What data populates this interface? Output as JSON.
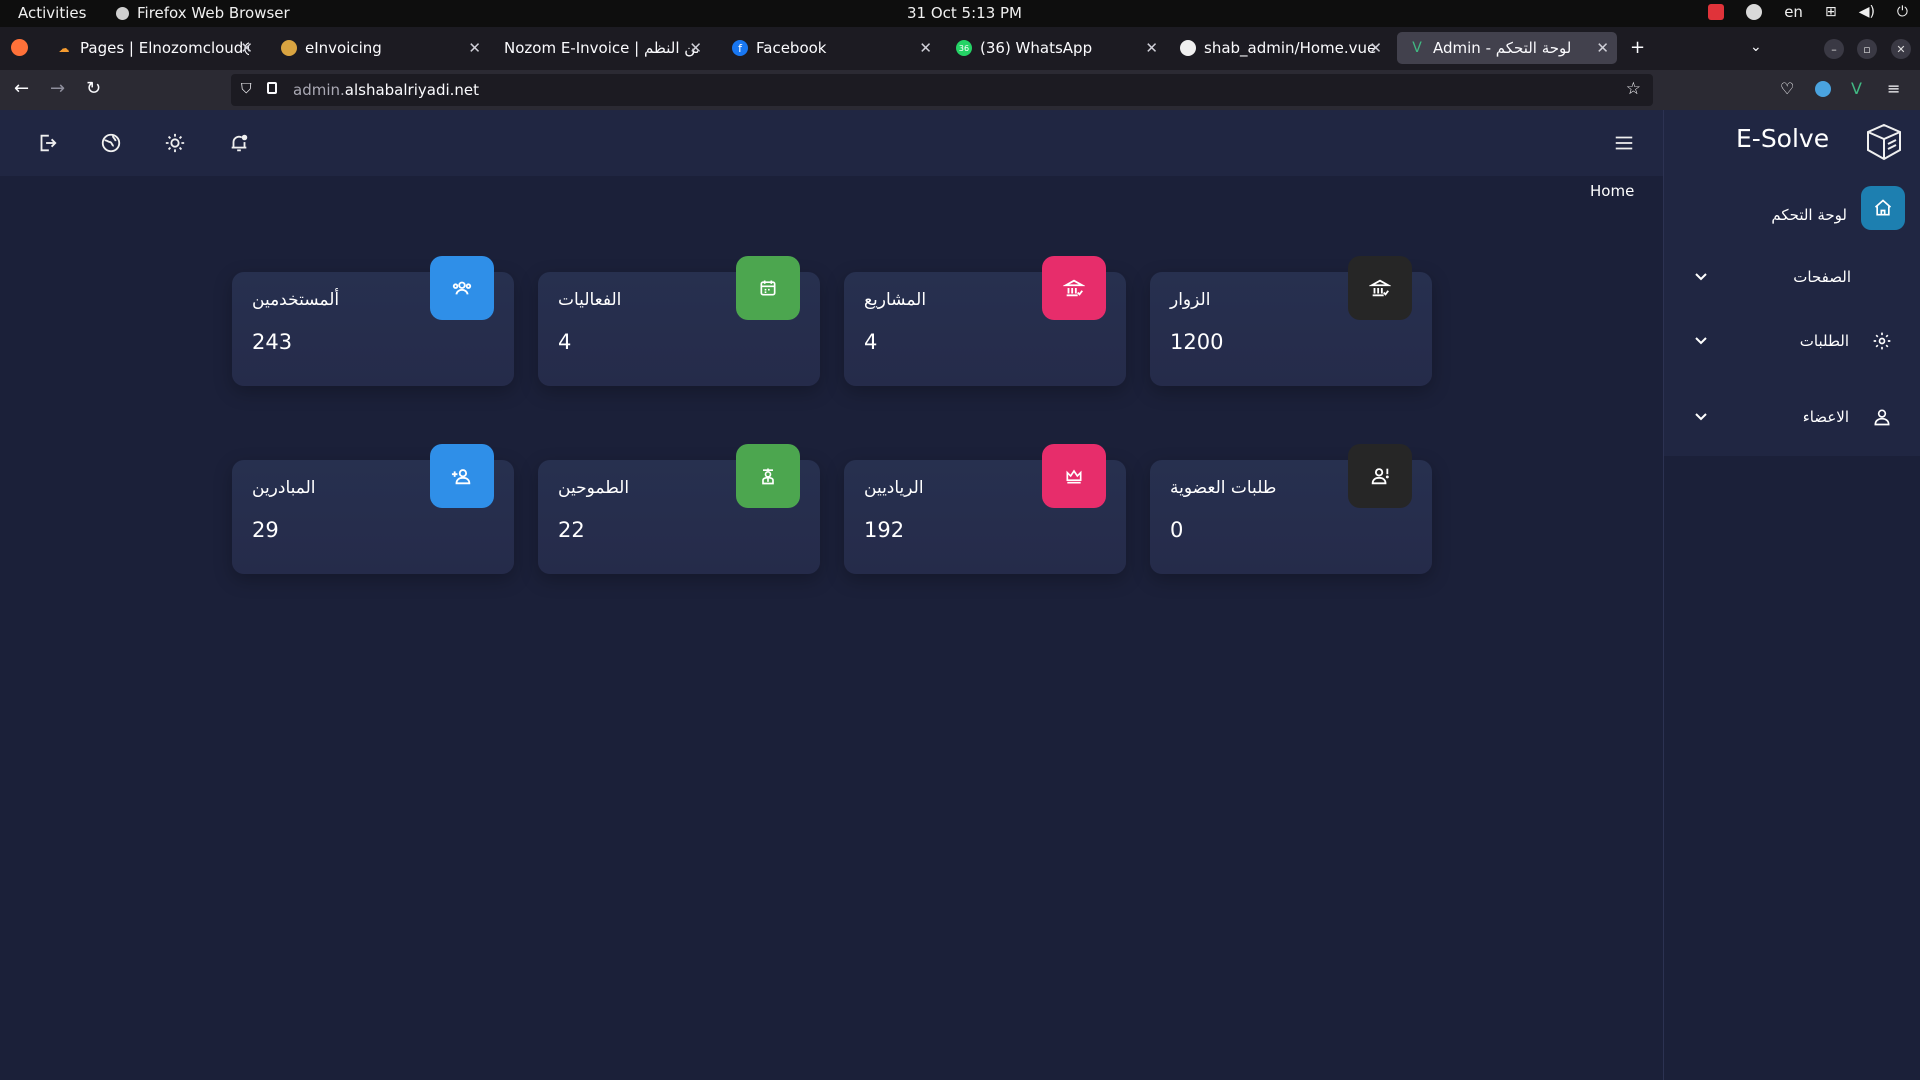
{
  "system_bar": {
    "activities": "Activities",
    "app_name": "Firefox Web Browser",
    "clock": "31 Oct  5:13 PM",
    "language": "en"
  },
  "browser": {
    "tabs": [
      {
        "title": "Pages | Elnozomcloud@g",
        "favicon": "cloud-icon",
        "active": false
      },
      {
        "title": "eInvoicing",
        "favicon": "burger-icon",
        "active": false
      },
      {
        "title": "Nozom E-Invoice | من النظم",
        "favicon": "none",
        "active": false
      },
      {
        "title": "Facebook",
        "favicon": "facebook-icon",
        "active": false
      },
      {
        "title": "(36) WhatsApp",
        "favicon": "whatsapp-icon",
        "active": false
      },
      {
        "title": "shab_admin/Home.vue a",
        "favicon": "github-icon",
        "active": false
      },
      {
        "title": "Admin - لوحة التحكم",
        "favicon": "vue-icon",
        "active": true
      }
    ],
    "url_prefix": "admin.",
    "url_domain": "alshabalriyadi.net"
  },
  "sidebar": {
    "brand": "E-Solve",
    "items": [
      {
        "label": "لوحة التحكم",
        "icon": "home-icon"
      },
      {
        "label": "الصفحات",
        "icon": "none"
      },
      {
        "label": "الطلبات",
        "icon": "gear-icon"
      },
      {
        "label": "الاعضاء",
        "icon": "user-icon"
      }
    ]
  },
  "breadcrumb": "Home",
  "stats": [
    {
      "title": "ألمستخدمين",
      "value": "243",
      "color": "#2f8fe8",
      "icon": "users-icon"
    },
    {
      "title": "الفعاليات",
      "value": "4",
      "color": "#4ca64f",
      "icon": "calendar-icon"
    },
    {
      "title": "المشاريع",
      "value": "4",
      "color": "#e72d6b",
      "icon": "bank-icon"
    },
    {
      "title": "الزوار",
      "value": "1200",
      "color": "#262626",
      "icon": "bank-check-icon"
    },
    {
      "title": "المبادرين",
      "value": "29",
      "color": "#2f8fe8",
      "icon": "user-add-icon"
    },
    {
      "title": "الطموحين",
      "value": "22",
      "color": "#4ca64f",
      "icon": "graduate-icon"
    },
    {
      "title": "الرياديين",
      "value": "192",
      "color": "#e72d6b",
      "icon": "crown-icon"
    },
    {
      "title": "طلبات العضوية",
      "value": "0",
      "color": "#262626",
      "icon": "user-alert-icon"
    }
  ]
}
